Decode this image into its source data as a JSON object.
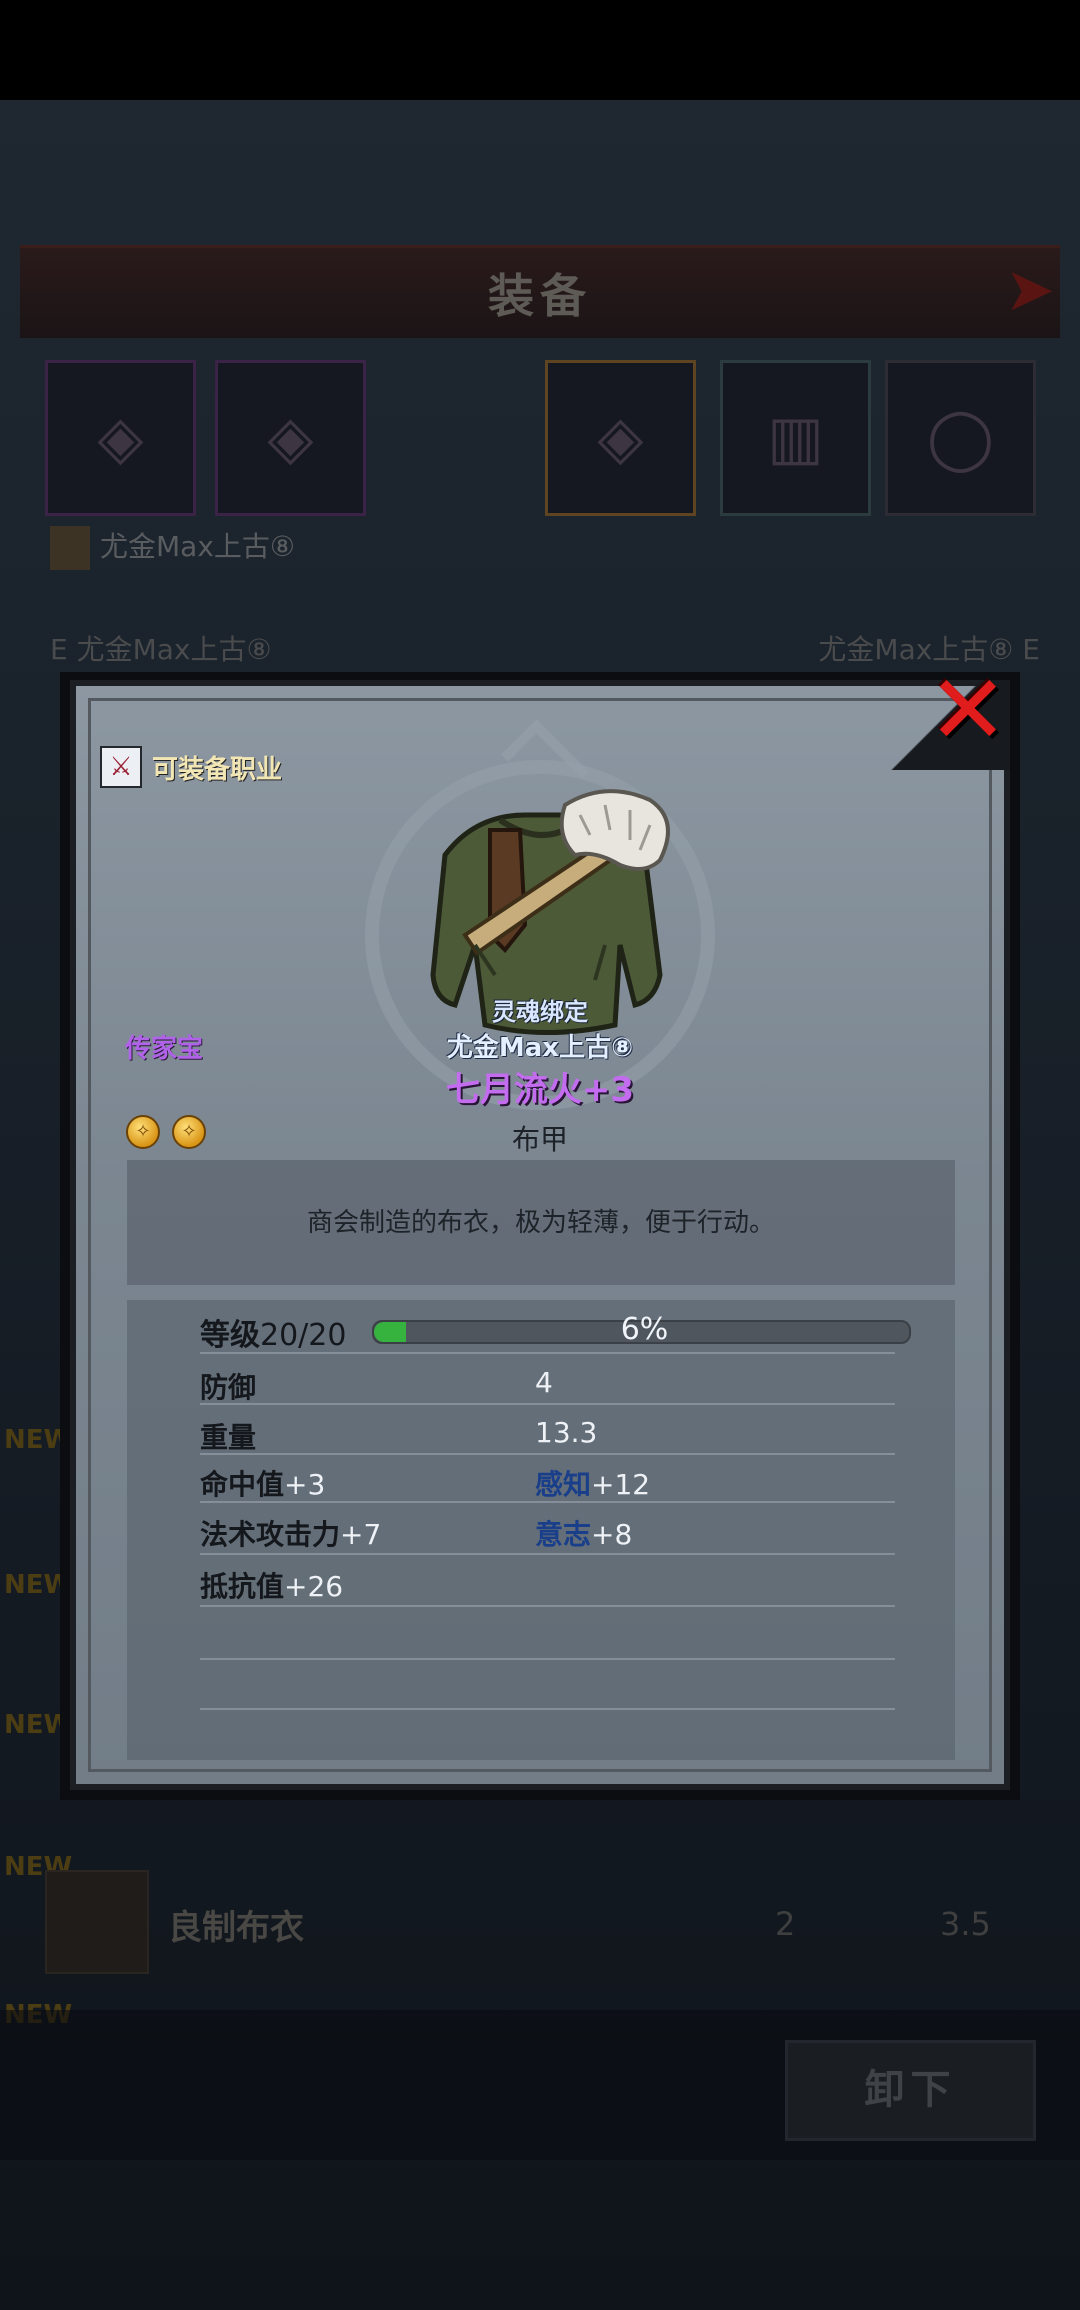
{
  "background_screen": {
    "title": "装备",
    "owner_name": "尤金Max上古⑧",
    "compare_left": "E 尤金Max上古⑧",
    "compare_right": "尤金Max上古⑧ E",
    "list_item": {
      "badge": "NEW",
      "name": "良制布衣",
      "value1": "2",
      "value2": "3.5"
    },
    "new_badges": [
      "NEW",
      "NEW",
      "NEW",
      "NEW",
      "NEW"
    ],
    "unequip_label": "卸下"
  },
  "dialog": {
    "close_icon": "close-x-icon",
    "class_label": "可装备职业",
    "rarity": "传家宝",
    "bind_status": "灵魂绑定",
    "owner": "尤金Max上古⑧",
    "item_name": "七月流火+3",
    "item_type": "布甲",
    "gem_count": 2,
    "description": "商会制造的布衣，极为轻薄，便于行动。",
    "level": {
      "label": "等级",
      "value": "20/20",
      "progress_text": "6%",
      "progress": 0.06
    },
    "stats": [
      {
        "left_label": "防御",
        "left_value": "",
        "right_value": "4"
      },
      {
        "left_label": "重量",
        "left_value": "",
        "right_value": "13.3"
      },
      {
        "left_label": "命中值",
        "left_value": "+3",
        "right_label": "感知",
        "right_value": "+12"
      },
      {
        "left_label": "法术攻击力",
        "left_value": "+7",
        "right_label": "意志",
        "right_value": "+8"
      },
      {
        "left_label": "抵抗值",
        "left_value": "+26"
      }
    ]
  },
  "colors": {
    "rarity": "#b063e8",
    "item_name": "#c46cf0",
    "close": "#e01c1c",
    "progress_fill": "#36b23f",
    "attr_label": "#1a3f8a"
  }
}
